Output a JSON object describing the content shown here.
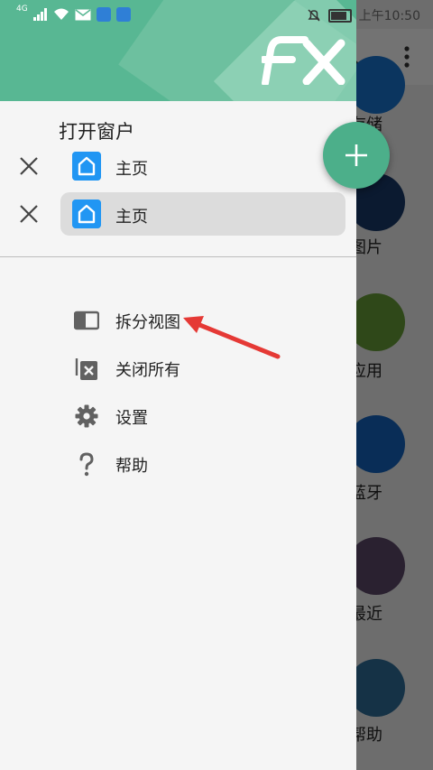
{
  "status_bar": {
    "network": "4G",
    "time": "上午10:50"
  },
  "drawer": {
    "section_title": "打开窗户",
    "windows": [
      {
        "label": "主页",
        "active": false
      },
      {
        "label": "主页",
        "active": true
      }
    ],
    "menu": [
      {
        "label": "拆分视图",
        "icon": "split-view-icon"
      },
      {
        "label": "关闭所有",
        "icon": "close-all-icon"
      },
      {
        "label": "设置",
        "icon": "gear-icon"
      },
      {
        "label": "帮助",
        "icon": "help-icon"
      }
    ]
  },
  "background_app": {
    "items": [
      {
        "label": "存储",
        "color": "#1976d2"
      },
      {
        "label": "图片",
        "color": "#1a3a6b"
      },
      {
        "label": "应用",
        "color": "#689f38"
      },
      {
        "label": "蓝牙",
        "color": "#1565c0"
      },
      {
        "label": "最近",
        "color": "#5e4b6b"
      },
      {
        "label": "帮助",
        "color": "#2f6f9c"
      }
    ]
  },
  "colors": {
    "accent": "#4caf8a",
    "header": "#58b793",
    "window_icon": "#2196f3",
    "arrow": "#e53935"
  }
}
